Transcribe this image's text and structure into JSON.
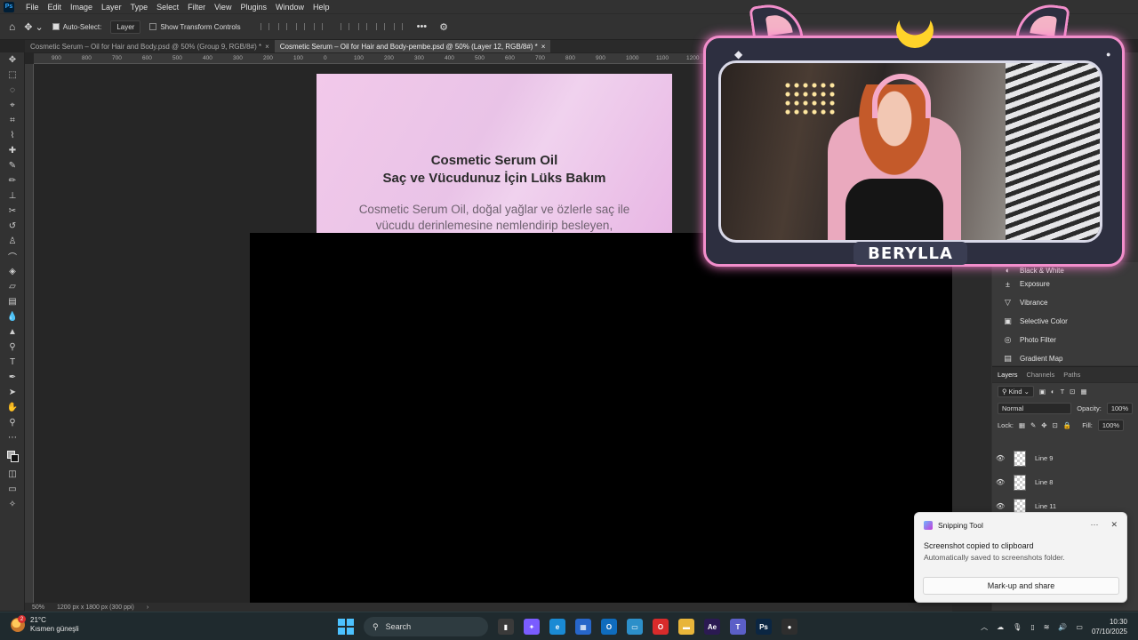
{
  "app": {
    "menu": [
      "File",
      "Edit",
      "Image",
      "Layer",
      "Type",
      "Select",
      "Filter",
      "View",
      "Plugins",
      "Window",
      "Help"
    ],
    "logo": "Ps"
  },
  "options_bar": {
    "auto_select_label": "Auto-Select:",
    "auto_select_value": "Layer",
    "show_transform_label": "Show Transform Controls"
  },
  "tabs": [
    {
      "label": "Cosmetic Serum – Oil for Hair and Body.psd @ 50% (Group 9, RGB/8#) *",
      "active": false
    },
    {
      "label": "Cosmetic Serum – Oil for Hair and Body-pembe.psd @ 50% (Layer 12, RGB/8#) *",
      "active": true
    }
  ],
  "ruler_ticks": [
    "900",
    "800",
    "700",
    "600",
    "500",
    "400",
    "300",
    "200",
    "100",
    "0",
    "100",
    "200",
    "300",
    "400",
    "500",
    "600",
    "700",
    "800",
    "900",
    "1000",
    "1100",
    "1200"
  ],
  "artboard": {
    "title": "Cosmetic Serum Oil",
    "subtitle": "Saç ve Vücudunuz İçin Lüks Bakım",
    "desc_line1": "Cosmetic Serum Oil, doğal yağlar ve özlerle saç ile",
    "desc_line2": "vücudu derinlemesine nemlendirip besleyen,"
  },
  "status": {
    "zoom": "50%",
    "doc_size": "1200 px x 1800 px (300 ppi)"
  },
  "adjustments": {
    "items": [
      {
        "label": "Black & White",
        "icon": "black-white-icon",
        "glyph": "◐"
      },
      {
        "label": "Exposure",
        "icon": "exposure-icon",
        "glyph": "±"
      },
      {
        "label": "Vibrance",
        "icon": "vibrance-icon",
        "glyph": "▽"
      },
      {
        "label": "Selective Color",
        "icon": "selective-color-icon",
        "glyph": "▣"
      },
      {
        "label": "Photo Filter",
        "icon": "photo-filter-icon",
        "glyph": "◎"
      },
      {
        "label": "Gradient Map",
        "icon": "gradient-map-icon",
        "glyph": "▤"
      }
    ]
  },
  "layers_panel": {
    "tabs": [
      "Layers",
      "Channels",
      "Paths"
    ],
    "kind_label": "Kind",
    "blend_mode": "Normal",
    "opacity_label": "Opacity:",
    "opacity_value": "100%",
    "lock_label": "Lock:",
    "fill_label": "Fill:",
    "fill_value": "100%",
    "layers": [
      "Line 9",
      "Line 8",
      "Line 11"
    ]
  },
  "stream": {
    "name": "BERYLLA"
  },
  "toast": {
    "app_name": "Snipping Tool",
    "more": "···",
    "close": "✕",
    "title": "Screenshot copied to clipboard",
    "body": "Automatically saved to screenshots folder.",
    "button": "Mark-up and share"
  },
  "taskbar": {
    "temperature": "21°C",
    "weather_text": "Kısmen güneşli",
    "weather_badge": "2",
    "search_placeholder": "Search",
    "time": "10:30",
    "date": "07/10/2025",
    "apps": [
      {
        "name": "file-explorer-black",
        "color": "#3a3a3a",
        "glyph": "▮"
      },
      {
        "name": "copilot",
        "color": "#7a5cff",
        "glyph": "✦"
      },
      {
        "name": "edge",
        "color": "#1a8ad4",
        "glyph": "e"
      },
      {
        "name": "store",
        "color": "#2766c9",
        "glyph": "▦"
      },
      {
        "name": "outlook",
        "color": "#0f6cbd",
        "glyph": "O"
      },
      {
        "name": "remote-desktop",
        "color": "#2c8fc9",
        "glyph": "▭"
      },
      {
        "name": "opera",
        "color": "#d82b2b",
        "glyph": "O"
      },
      {
        "name": "file-explorer",
        "color": "#e8b53a",
        "glyph": "▬"
      },
      {
        "name": "after-effects",
        "color": "#2b1a52",
        "glyph": "Ae"
      },
      {
        "name": "teams",
        "color": "#5b5fc7",
        "glyph": "T"
      },
      {
        "name": "photoshop",
        "color": "#0b2642",
        "glyph": "Ps"
      },
      {
        "name": "obs",
        "color": "#2e2e2e",
        "glyph": "●"
      }
    ]
  }
}
